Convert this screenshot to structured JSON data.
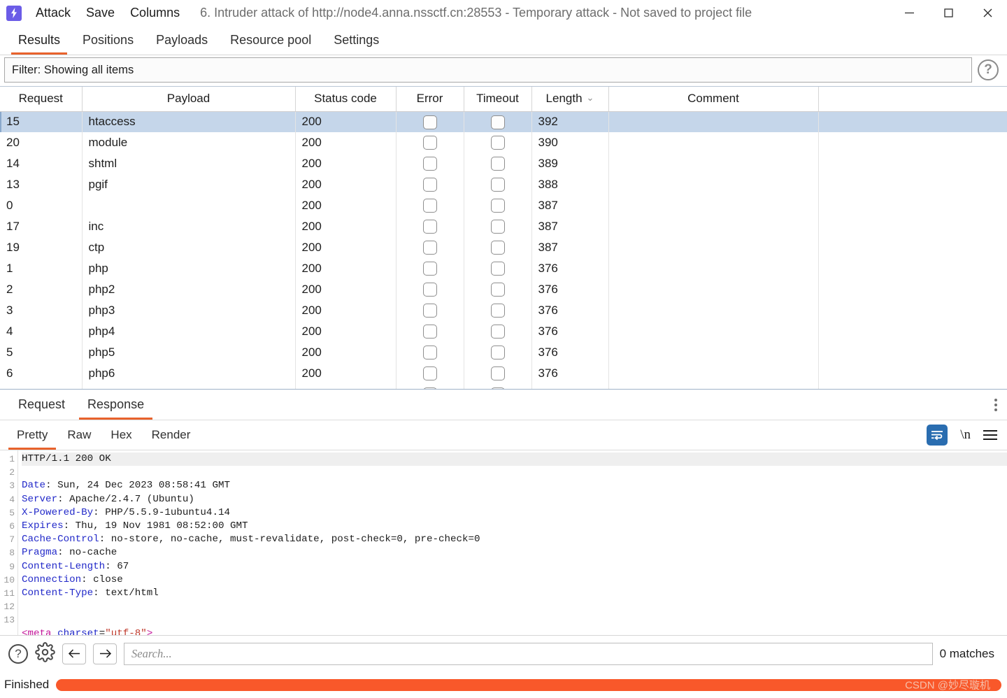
{
  "window": {
    "logo_icon": "burp-lightning-icon",
    "menu": [
      {
        "label": "Attack"
      },
      {
        "label": "Save"
      },
      {
        "label": "Columns"
      }
    ],
    "title": "6. Intruder attack of http://node4.anna.nssctf.cn:28553 - Temporary attack - Not saved to project file",
    "controls": [
      {
        "name": "minimize",
        "glyph": "—"
      },
      {
        "name": "maximize",
        "glyph": "□"
      },
      {
        "name": "close",
        "glyph": "✕"
      }
    ]
  },
  "main_tabs": [
    {
      "label": "Results",
      "active": true
    },
    {
      "label": "Positions",
      "active": false
    },
    {
      "label": "Payloads",
      "active": false
    },
    {
      "label": "Resource pool",
      "active": false
    },
    {
      "label": "Settings",
      "active": false
    }
  ],
  "filter": {
    "text": "Filter: Showing all items",
    "help_icon": "question-mark-icon"
  },
  "results_table": {
    "columns": [
      "Request",
      "Payload",
      "Status code",
      "Error",
      "Timeout",
      "Length",
      "Comment"
    ],
    "sorted_column": "Length",
    "sort_caret": "⌄",
    "rows": [
      {
        "request": "15",
        "payload": "htaccess",
        "status": "200",
        "error": false,
        "timeout": false,
        "length": "392",
        "comment": "",
        "selected": true
      },
      {
        "request": "20",
        "payload": "module",
        "status": "200",
        "error": false,
        "timeout": false,
        "length": "390",
        "comment": "",
        "selected": false
      },
      {
        "request": "14",
        "payload": "shtml",
        "status": "200",
        "error": false,
        "timeout": false,
        "length": "389",
        "comment": "",
        "selected": false
      },
      {
        "request": "13",
        "payload": "pgif",
        "status": "200",
        "error": false,
        "timeout": false,
        "length": "388",
        "comment": "",
        "selected": false
      },
      {
        "request": "0",
        "payload": "",
        "status": "200",
        "error": false,
        "timeout": false,
        "length": "387",
        "comment": "",
        "selected": false
      },
      {
        "request": "17",
        "payload": "inc",
        "status": "200",
        "error": false,
        "timeout": false,
        "length": "387",
        "comment": "",
        "selected": false
      },
      {
        "request": "19",
        "payload": "ctp",
        "status": "200",
        "error": false,
        "timeout": false,
        "length": "387",
        "comment": "",
        "selected": false
      },
      {
        "request": "1",
        "payload": "php",
        "status": "200",
        "error": false,
        "timeout": false,
        "length": "376",
        "comment": "",
        "selected": false
      },
      {
        "request": "2",
        "payload": "php2",
        "status": "200",
        "error": false,
        "timeout": false,
        "length": "376",
        "comment": "",
        "selected": false
      },
      {
        "request": "3",
        "payload": "php3",
        "status": "200",
        "error": false,
        "timeout": false,
        "length": "376",
        "comment": "",
        "selected": false
      },
      {
        "request": "4",
        "payload": "php4",
        "status": "200",
        "error": false,
        "timeout": false,
        "length": "376",
        "comment": "",
        "selected": false
      },
      {
        "request": "5",
        "payload": "php5",
        "status": "200",
        "error": false,
        "timeout": false,
        "length": "376",
        "comment": "",
        "selected": false
      },
      {
        "request": "6",
        "payload": "php6",
        "status": "200",
        "error": false,
        "timeout": false,
        "length": "376",
        "comment": "",
        "selected": false
      }
    ]
  },
  "message_panel": {
    "tabs": [
      {
        "label": "Request",
        "active": false
      },
      {
        "label": "Response",
        "active": true
      }
    ],
    "kebab_icon": "vertical-dots-icon",
    "format_tabs": [
      {
        "label": "Pretty",
        "active": true
      },
      {
        "label": "Raw",
        "active": false
      },
      {
        "label": "Hex",
        "active": false
      },
      {
        "label": "Render",
        "active": false
      }
    ],
    "tools": [
      {
        "name": "word-wrap-icon",
        "label": ""
      },
      {
        "name": "newline-icon",
        "label": "\\n"
      },
      {
        "name": "hamburger-menu-icon",
        "label": ""
      }
    ]
  },
  "response": {
    "lines": [
      {
        "n": "1",
        "text": "HTTP/1.1 200 OK"
      },
      {
        "n": "2",
        "header": "Date",
        "text": ": Sun, 24 Dec 2023 08:58:41 GMT"
      },
      {
        "n": "3",
        "header": "Server",
        "text": ": Apache/2.4.7 (Ubuntu)"
      },
      {
        "n": "4",
        "header": "X-Powered-By",
        "text": ": PHP/5.5.9-1ubuntu4.14"
      },
      {
        "n": "5",
        "header": "Expires",
        "text": ": Thu, 19 Nov 1981 08:52:00 GMT"
      },
      {
        "n": "6",
        "header": "Cache-Control",
        "text": ": no-store, no-cache, must-revalidate, post-check=0, pre-check=0"
      },
      {
        "n": "7",
        "header": "Pragma",
        "text": ": no-cache"
      },
      {
        "n": "8",
        "header": "Content-Length",
        "text": ": 67"
      },
      {
        "n": "9",
        "header": "Connection",
        "text": ": close"
      },
      {
        "n": "10",
        "header": "Content-Type",
        "text": ": text/html"
      },
      {
        "n": "11",
        "text": ""
      },
      {
        "n": "12",
        "text": ""
      },
      {
        "n": "13",
        "markup": "<meta charset=\"utf-8\">"
      }
    ]
  },
  "search": {
    "help_icon": "question-mark-icon",
    "settings_icon": "gear-icon",
    "prev_icon": "arrow-left-icon",
    "next_icon": "arrow-right-icon",
    "placeholder": "Search...",
    "value": "",
    "matches": "0 matches"
  },
  "status": {
    "text": "Finished",
    "progress_percent": 100,
    "progress_color": "#f9582a",
    "watermark": "CSDN @妙尽璇机"
  },
  "colors": {
    "accent": "#e8622c",
    "logo": "#6b5ce7",
    "selection": "#c5d6ea",
    "header_blue": "#2229c9",
    "tag_pink": "#c4179b",
    "string_red": "#c0392b"
  }
}
